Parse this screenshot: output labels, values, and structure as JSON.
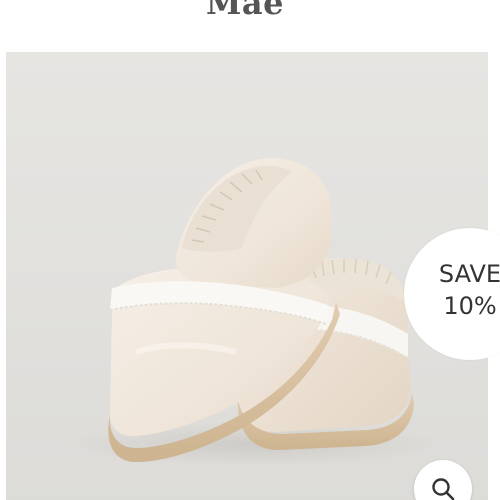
{
  "product": {
    "title": "Mae"
  },
  "badge": {
    "line1": "SAVE",
    "line2": "10%"
  },
  "zoom": {
    "icon": "search-icon"
  },
  "colors": {
    "title": "#555555",
    "badge_bg": "#ffffff",
    "badge_text": "#333333",
    "photo_bg": "#e2e1de",
    "shoe_leather": "#f1e9df",
    "shoe_sole": "#d9c3a6",
    "lace_trim": "#f8f6f2"
  }
}
